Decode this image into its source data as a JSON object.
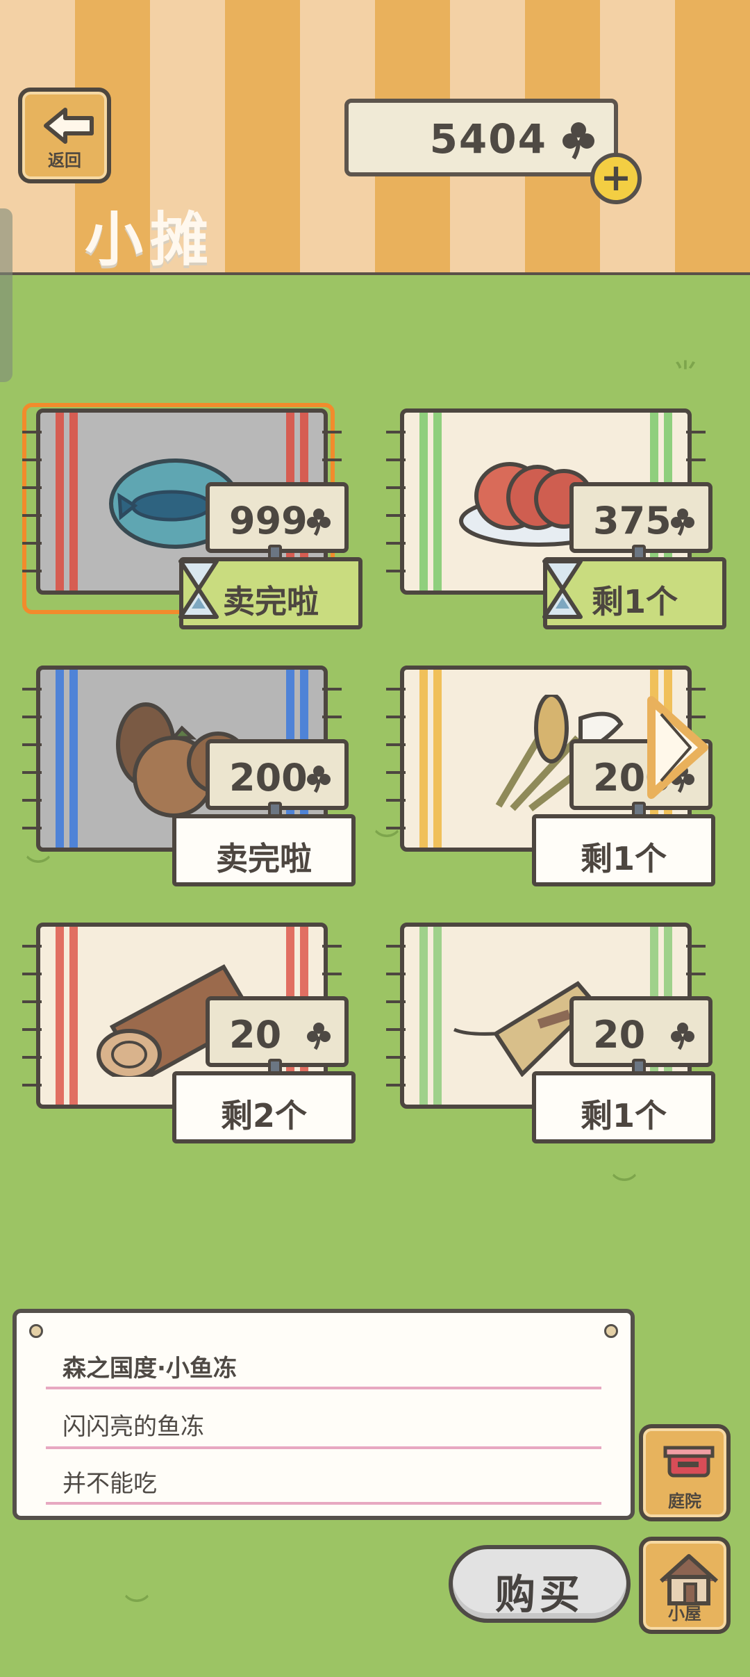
{
  "header": {
    "back_label": "返回",
    "coin_balance": "5404",
    "shop_title": "小摊"
  },
  "items": [
    {
      "name": "小鱼冻",
      "price": "999",
      "stock": "卖完啦",
      "selected": true
    },
    {
      "name": "香肠",
      "price": "375",
      "stock": "剩1个",
      "selected": false
    },
    {
      "name": "松果与栗子",
      "price": "200",
      "stock": "卖完啦",
      "selected": false
    },
    {
      "name": "芦苇束",
      "price": "200",
      "stock": "剩1个",
      "selected": false
    },
    {
      "name": "木柴",
      "price": "20",
      "stock": "剩2个",
      "selected": false
    },
    {
      "name": "草绳包",
      "price": "20",
      "stock": "剩1个",
      "selected": false
    }
  ],
  "description": {
    "title": "森之国度·小鱼冻",
    "line1": "闪闪亮的鱼冻",
    "line2": "并不能吃"
  },
  "buttons": {
    "buy": "购买",
    "garden": "庭院",
    "house": "小屋"
  },
  "colors": {
    "top_stripe_light": "#f3d1a5",
    "top_stripe_dark": "#e9b15c",
    "grass": "#9cc464",
    "selection": "#f28b2c",
    "special_stock": "#c9dc7f"
  },
  "icons": {
    "back": "back-arrow-icon",
    "currency": "clover-icon",
    "add": "plus-icon",
    "next": "chevron-right-icon",
    "timer": "hourglass-icon",
    "garden": "garden-icon",
    "house": "house-icon"
  }
}
